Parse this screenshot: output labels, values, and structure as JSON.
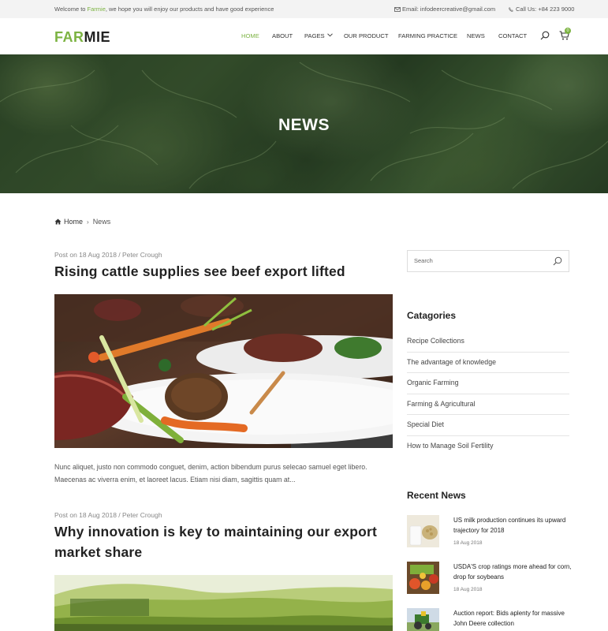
{
  "topbar": {
    "welcome_prefix": "Welcome to ",
    "welcome_brand": "Farmie",
    "welcome_suffix": ", we hope you will enjoy our products and have good experience",
    "email": "Email: infodeercreative@gmail.com",
    "phone": "Call Us: +84 223 9000"
  },
  "header": {
    "logo_part1": "FAR",
    "logo_part2": "MIE",
    "nav": [
      "HOME",
      "ABOUT",
      "PAGES",
      "OUR PRODUCT",
      "FARMING PRACTICE",
      "NEWS",
      "CONTACT"
    ],
    "active_nav": "HOME",
    "cart_count": "0"
  },
  "hero": {
    "title": "NEWS"
  },
  "breadcrumb": {
    "home": "Home",
    "current": "News"
  },
  "posts": [
    {
      "meta": "Post on 18 Aug 2018 / Peter Crough",
      "title": "Rising cattle supplies see beef export lifted",
      "excerpt": "Nunc aliquet, justo non commodo conguet, denim, action bibendum purus selecao samuel eget libero. Maecenas ac viverra enim, et laoreet lacus. Etiam nisi diam, sagittis quam at..."
    },
    {
      "meta": "Post on 18 Aug 2018 / Peter Crough",
      "title_line1": "Why innovation is key to maintaining our export",
      "title_line2": "market share"
    }
  ],
  "sidebar": {
    "search_placeholder": "Search",
    "categories_title": "Catagories",
    "categories": [
      "Recipe Collections",
      "The advantage of knowledge",
      "Organic Farming",
      "Farming & Agricultural",
      "Special Diet",
      "How to Manage Soil Fertility"
    ],
    "recent_title": "Recent News",
    "recent": [
      {
        "title": "US milk production continues its upward trajectory for 2018",
        "date": "18 Aug 2018"
      },
      {
        "title": "USDA'S crop ratings more ahead for corn, drop for soybeans",
        "date": "18 Aug 2018"
      },
      {
        "title": "Auction report: Bids aplenty for massive John Deere collection",
        "date": ""
      }
    ]
  },
  "colors": {
    "accent": "#7cb342",
    "text": "#222222",
    "muted": "#888888"
  }
}
